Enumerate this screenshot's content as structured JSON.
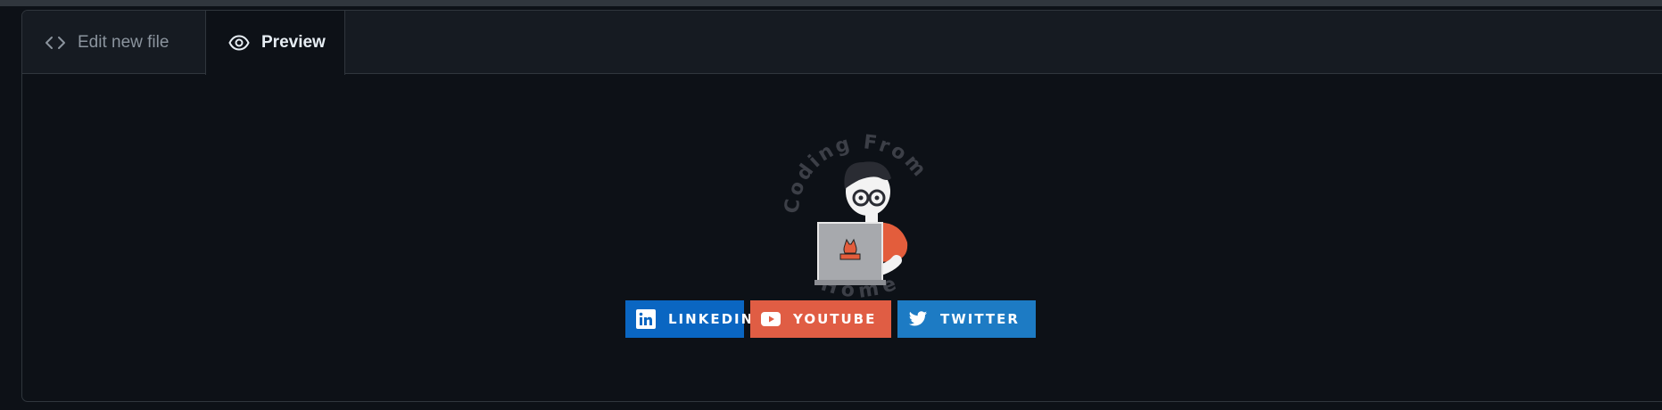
{
  "tabs": {
    "edit_label": "Edit new file",
    "preview_label": "Preview"
  },
  "illustration": {
    "top_text": "Coding From",
    "bottom_text": "Home"
  },
  "badges": [
    {
      "label": "LINKEDIN",
      "icon": "linkedin-icon",
      "color": "#0a66c2"
    },
    {
      "label": "YOUTUBE",
      "icon": "youtube-icon",
      "color": "#e05d44"
    },
    {
      "label": "TWITTER",
      "icon": "twitter-icon",
      "color": "#1d7bc4"
    }
  ]
}
